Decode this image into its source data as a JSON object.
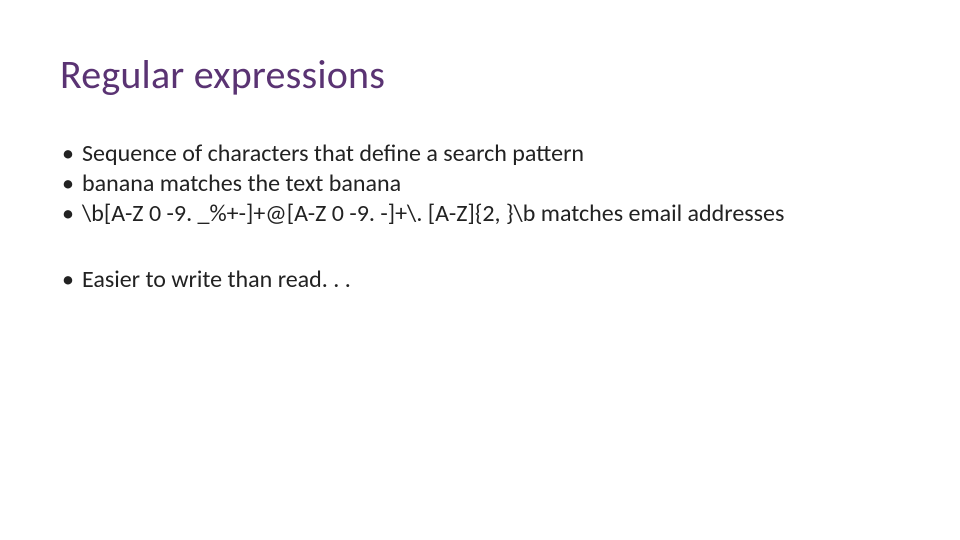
{
  "title": "Regular expressions",
  "bullets_group1": [
    "Sequence of characters that define a search pattern",
    "banana matches the text banana",
    "\\b[A-Z 0 -9. _%+-]+@[A-Z 0 -9. -]+\\. [A-Z]{2, }\\b matches email addresses"
  ],
  "bullets_group2": [
    "Easier to write than read. . ."
  ]
}
